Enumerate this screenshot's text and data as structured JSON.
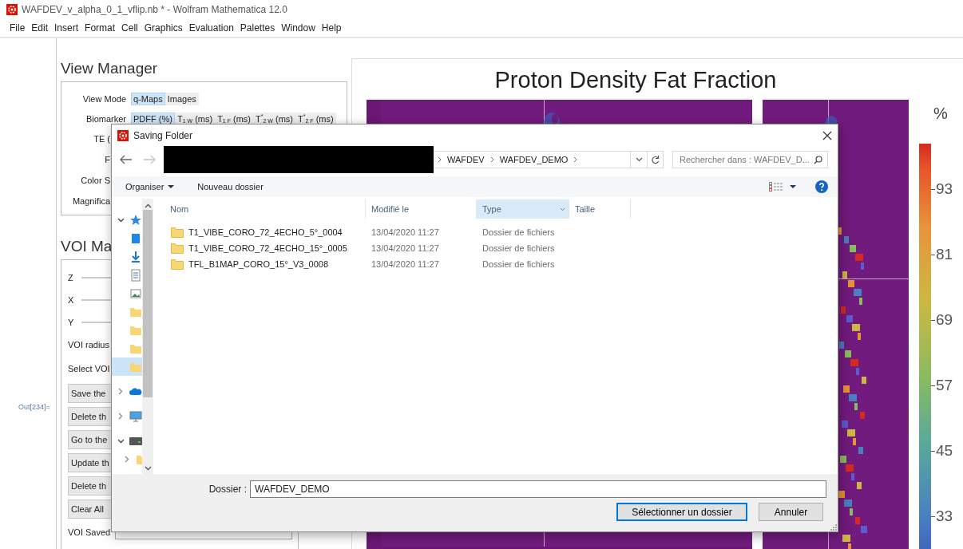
{
  "window": {
    "title": "WAFDEV_v_alpha_0_1_vflip.nb * - Wolfram Mathematica 12.0"
  },
  "menu": [
    "File",
    "Edit",
    "Insert",
    "Format",
    "Cell",
    "Graphics",
    "Evaluation",
    "Palettes",
    "Window",
    "Help"
  ],
  "cell_label": "Out[234]=",
  "view_manager": {
    "title": "View Manager",
    "rows": [
      {
        "kind": "toggle",
        "label": "View Mode",
        "options": [
          {
            "label": "q-Maps",
            "selected": true
          },
          {
            "label": "Images",
            "selected": false
          }
        ]
      },
      {
        "kind": "toggle",
        "label": "Biomarker",
        "options": [
          {
            "label": "PDFF (%)",
            "selected": true
          },
          {
            "label": "T$_{1 W}$ (ms)",
            "selected": false
          },
          {
            "label": "T$_{1 F}$ (ms)",
            "selected": false
          },
          {
            "label": "T$^{*}$$_{2 W}$ (ms)",
            "selected": false
          },
          {
            "label": "T$^{*}$$_{2 F}$ (ms)",
            "selected": false
          }
        ]
      },
      {
        "kind": "label",
        "label": "TE ("
      },
      {
        "kind": "label",
        "label": "F"
      },
      {
        "kind": "label",
        "label": "Color S"
      },
      {
        "kind": "label",
        "label": "Magnifica"
      }
    ]
  },
  "voi_manager": {
    "title": "VOI Ma",
    "rows": [
      {
        "kind": "slider",
        "label": "Z"
      },
      {
        "kind": "slider",
        "label": "X"
      },
      {
        "kind": "slider",
        "label": "Y"
      },
      {
        "kind": "label",
        "label": "VOI radius"
      },
      {
        "kind": "label",
        "label": "Select VOI"
      },
      {
        "kind": "button",
        "label": "Save the"
      },
      {
        "kind": "button",
        "label": "Delete th"
      },
      {
        "kind": "button",
        "label": "Go to the"
      },
      {
        "kind": "button",
        "label": "Update th"
      },
      {
        "kind": "button",
        "label": "Delete th"
      },
      {
        "kind": "button",
        "label": "Clear All"
      },
      {
        "kind": "field",
        "label": "VOI Saved"
      }
    ]
  },
  "plot": {
    "title": "Proton Density Fat Fraction",
    "unit": "%",
    "ticks": [
      "93",
      "81",
      "69",
      "57",
      "45",
      "33"
    ]
  },
  "dialog": {
    "title": "Saving Folder",
    "path": [
      "WAFDEV",
      "WAFDEV_DEMO"
    ],
    "search_placeholder": "Rechercher dans : WAFDEV_D...",
    "organize": "Organiser",
    "new_folder": "Nouveau dossier",
    "nav": [
      {
        "kind": "quick_access",
        "expanded": true,
        "selected": false
      },
      {
        "kind": "desktop",
        "selected": false
      },
      {
        "kind": "downloads",
        "selected": false
      },
      {
        "kind": "documents",
        "selected": false
      },
      {
        "kind": "pictures",
        "selected": false
      },
      {
        "kind": "folder",
        "selected": false
      },
      {
        "kind": "folder",
        "selected": false
      },
      {
        "kind": "folder",
        "selected": false
      },
      {
        "kind": "folder",
        "selected": true
      },
      {
        "kind": "cloud",
        "expanded": false,
        "selected": false
      },
      {
        "kind": "pc",
        "expanded": false,
        "selected": false
      },
      {
        "kind": "drive",
        "expanded": true,
        "selected": false
      },
      {
        "kind": "child_folder",
        "expanded": false,
        "selected": false
      }
    ],
    "columns": [
      {
        "label": "Nom",
        "selected": false
      },
      {
        "label": "Modifié le",
        "selected": false
      },
      {
        "label": "Type",
        "selected": true
      },
      {
        "label": "Taille",
        "selected": false
      }
    ],
    "rows": [
      {
        "name": "T1_VIBE_CORO_72_4ECHO_5°_0004",
        "modified": "13/04/2020 11:27",
        "type": "Dossier de fichiers"
      },
      {
        "name": "T1_VIBE_CORO_72_4ECHO_15°_0005",
        "modified": "13/04/2020 11:27",
        "type": "Dossier de fichiers"
      },
      {
        "name": "TFL_B1MAP_CORO_15°_V3_0008",
        "modified": "13/04/2020 11:27",
        "type": "Dossier de fichiers"
      }
    ],
    "folder_label": "Dossier :",
    "folder_value": "WAFDEV_DEMO",
    "buttons": [
      {
        "label": "Sélectionner un dossier",
        "kind": "primary"
      },
      {
        "label": "Annuler",
        "kind": "secondary"
      }
    ]
  }
}
